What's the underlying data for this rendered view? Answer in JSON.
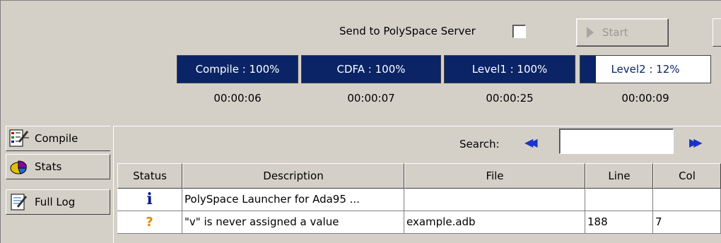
{
  "options": {
    "send_label": "Send to PolySpace Server",
    "send_checked": false
  },
  "toolbar": {
    "start_label": "Start"
  },
  "progress": [
    {
      "label": "Compile : 100%",
      "percent": 100,
      "time": "00:00:06"
    },
    {
      "label": "CDFA : 100%",
      "percent": 100,
      "time": "00:00:07"
    },
    {
      "label": "Level1 : 100%",
      "percent": 100,
      "time": "00:00:25"
    },
    {
      "label": "Level2 : 12%",
      "percent": 12,
      "time": "00:00:09"
    }
  ],
  "tabs": [
    {
      "label": "Compile",
      "icon": "compile-icon"
    },
    {
      "label": "Stats",
      "icon": "stats-icon"
    },
    {
      "label": "Full Log",
      "icon": "full-log-icon"
    }
  ],
  "search": {
    "label": "Search:",
    "value": ""
  },
  "table": {
    "columns": [
      "Status",
      "Description",
      "File",
      "Line",
      "Col"
    ],
    "rows": [
      {
        "status_icon": "info-icon",
        "status_color": "#0a1a8c",
        "description": "PolySpace Launcher for Ada95 ...",
        "file": "",
        "line": "",
        "col": ""
      },
      {
        "status_icon": "question-icon",
        "status_color": "#e08a00",
        "description": " \"v\" is never assigned a value",
        "file": "example.adb",
        "line": "188",
        "col": "7"
      }
    ]
  },
  "colors": {
    "progress_fill": "#0a2466",
    "window_bg": "#d4d0c8",
    "arrow_blue": "#1b34c8"
  }
}
